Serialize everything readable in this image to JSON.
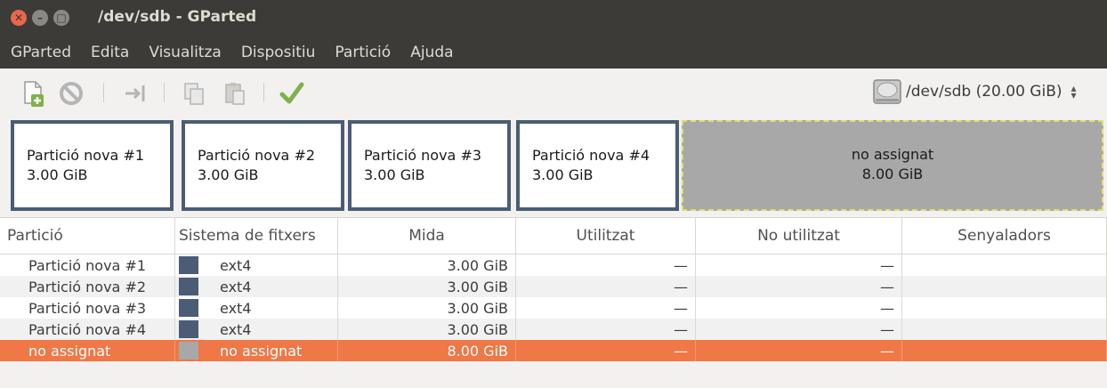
{
  "window": {
    "title": "/dev/sdb - GParted"
  },
  "menubar": [
    "GParted",
    "Edita",
    "Visualitza",
    "Dispositiu",
    "Partició",
    "Ajuda"
  ],
  "toolbar": {
    "device": "/dev/sdb  (20.00 GiB)"
  },
  "graph": {
    "partitions": [
      {
        "name": "Partició nova #1",
        "size": "3.00 GiB"
      },
      {
        "name": "Partició nova #2",
        "size": "3.00 GiB"
      },
      {
        "name": "Partició nova #3",
        "size": "3.00 GiB"
      },
      {
        "name": "Partició nova #4",
        "size": "3.00 GiB"
      }
    ],
    "unallocated": {
      "name": "no assignat",
      "size": "8.00 GiB"
    }
  },
  "table": {
    "headers": [
      "Partició",
      "Sistema de fitxers",
      "Mida",
      "Utilitzat",
      "No utilitzat",
      "Senyaladors"
    ],
    "rows": [
      {
        "partition": "Partició nova #1",
        "filesystem": "ext4",
        "size": "3.00 GiB",
        "used": "—",
        "unused": "—",
        "flags": "",
        "color": "#4a5d74"
      },
      {
        "partition": "Partició nova #2",
        "filesystem": "ext4",
        "size": "3.00 GiB",
        "used": "—",
        "unused": "—",
        "flags": "",
        "color": "#4a5d74"
      },
      {
        "partition": "Partició nova #3",
        "filesystem": "ext4",
        "size": "3.00 GiB",
        "used": "—",
        "unused": "—",
        "flags": "",
        "color": "#4a5d74"
      },
      {
        "partition": "Partició nova #4",
        "filesystem": "ext4",
        "size": "3.00 GiB",
        "used": "—",
        "unused": "—",
        "flags": "",
        "color": "#4a5d74"
      },
      {
        "partition": "no assignat",
        "filesystem": "no assignat",
        "size": "8.00 GiB",
        "used": "—",
        "unused": "—",
        "flags": "",
        "color": "#a8a8a8"
      }
    ],
    "selected_row": 4
  },
  "colors": {
    "accent": "#f07746",
    "ext4": "#4a5d74",
    "unallocated": "#a8a8a8",
    "titlebar": "#3c3b37"
  }
}
